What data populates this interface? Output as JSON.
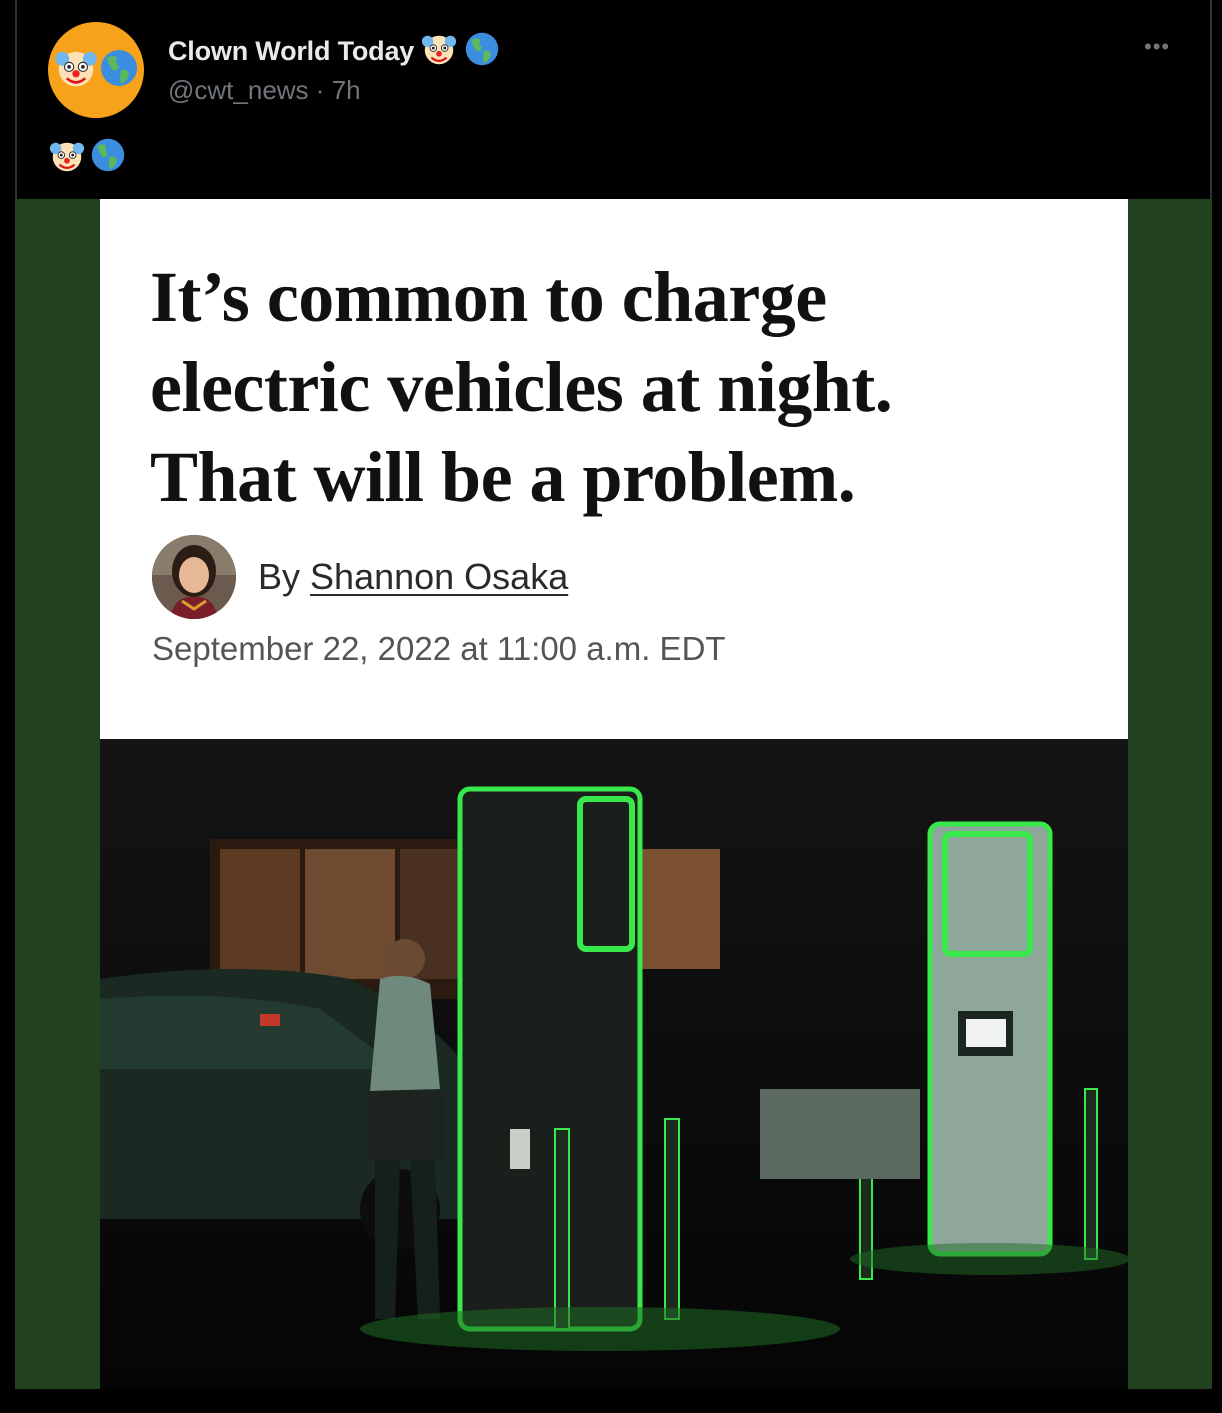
{
  "post": {
    "display_name": "Clown World Today",
    "handle": "@cwt_news",
    "separator": "·",
    "time": "7h",
    "more_label": "•••",
    "name_emojis": [
      "clown-face",
      "globe-americas"
    ],
    "body_emojis": [
      "clown-face",
      "globe-americas"
    ]
  },
  "article": {
    "headline_lines": [
      "It’s common to charge",
      "electric vehicles at night.",
      "That will be a problem."
    ],
    "by_prefix": "By",
    "author": "Shannon Osaka",
    "date": "September 22, 2022 at 11:00 a.m. EDT"
  },
  "colors": {
    "background": "#000000",
    "media_backdrop": "#22411f",
    "avatar_orange": "#f7a21b",
    "charger_glow": "#39e84a"
  },
  "photo": {
    "subject": "person charging electric vehicle at night beside glowing green chargers"
  }
}
